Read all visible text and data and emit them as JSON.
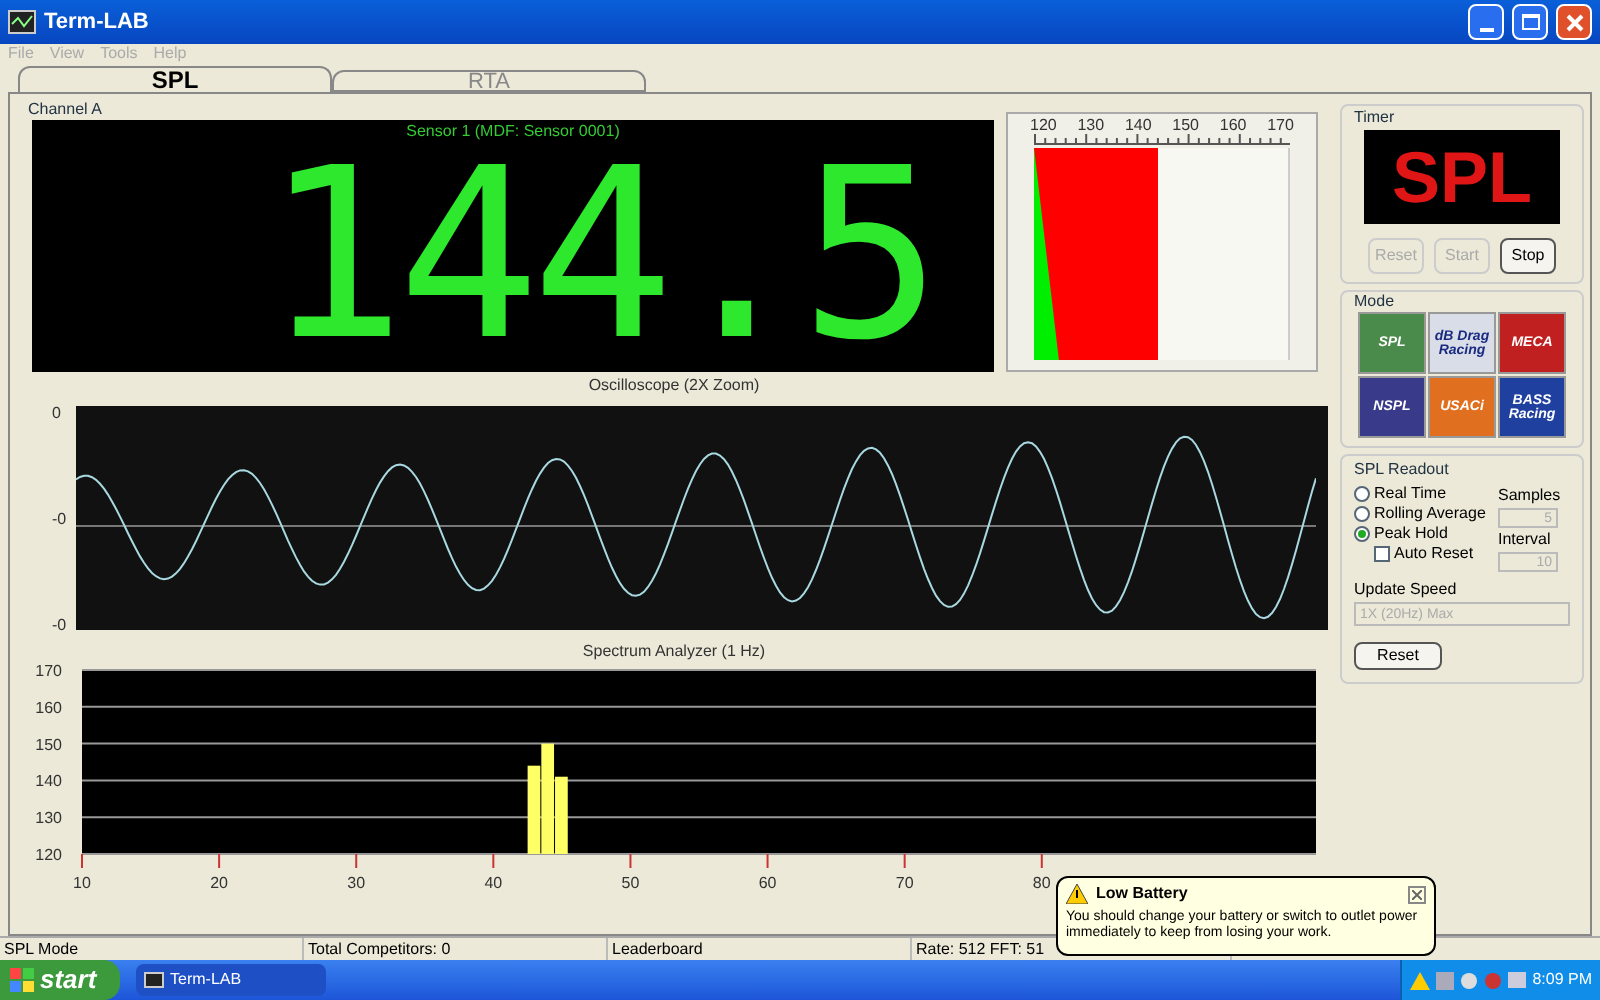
{
  "window": {
    "title": "Term-LAB"
  },
  "menu": [
    "File",
    "View",
    "Tools",
    "Help"
  ],
  "tabs": [
    {
      "label": "SPL",
      "selected": true
    },
    {
      "label": "RTA",
      "selected": false
    }
  ],
  "channel": {
    "title": "Channel A",
    "sensor": "Sensor 1 (MDF: Sensor 0001)",
    "reading": "144.5"
  },
  "meter": {
    "ticks": [
      "120",
      "130",
      "140",
      "150",
      "160",
      "170"
    ],
    "level": 0.49
  },
  "oscilloscope": {
    "title": "Oscilloscope (2X Zoom)",
    "y_labels": [
      "0",
      "-0",
      "-0"
    ]
  },
  "spectrum": {
    "title": "Spectrum Analyzer (1 Hz)",
    "chart_data": {
      "type": "bar",
      "grid": true,
      "x": [
        43,
        44,
        45
      ],
      "values": [
        144,
        150,
        141
      ],
      "xlim": [
        10,
        100
      ],
      "ylim": [
        120,
        170
      ],
      "xticks": [
        10,
        20,
        30,
        40,
        50,
        60,
        70,
        80
      ],
      "yticks": [
        120,
        130,
        140,
        150,
        160,
        170
      ]
    }
  },
  "timer": {
    "title": "Timer",
    "display": "SPL",
    "buttons": [
      {
        "label": "Reset",
        "disabled": true
      },
      {
        "label": "Start",
        "disabled": true
      },
      {
        "label": "Stop",
        "disabled": false
      }
    ]
  },
  "mode": {
    "title": "Mode",
    "logos": [
      {
        "label": "SPL",
        "color": "#4a8a4a"
      },
      {
        "label": "dB Drag Racing",
        "color": "#d8dde8"
      },
      {
        "label": "MECA",
        "color": "#c02020"
      },
      {
        "label": "NSPL",
        "color": "#3a3a8a"
      },
      {
        "label": "USACi",
        "color": "#e07020"
      },
      {
        "label": "BASS Racing",
        "color": "#2040a0"
      }
    ]
  },
  "readout": {
    "title": "SPL Readout",
    "options": [
      {
        "label": "Real Time",
        "selected": false
      },
      {
        "label": "Rolling Average",
        "selected": false
      },
      {
        "label": "Peak Hold",
        "selected": true
      }
    ],
    "auto_reset": {
      "label": "Auto Reset",
      "checked": false
    },
    "samples": {
      "label": "Samples",
      "value": "5"
    },
    "interval": {
      "label": "Interval",
      "value": "10"
    },
    "update_speed": {
      "label": "Update Speed",
      "value": "1X (20Hz) Max"
    },
    "reset": "Reset"
  },
  "status_bar": [
    "SPL Mode",
    "Total Competitors: 0",
    "Leaderboard",
    "Rate: 512 FFT: 51"
  ],
  "taskbar": {
    "start": "start",
    "task": "Term-LAB",
    "clock": "8:09 PM"
  },
  "balloon": {
    "title": "Low Battery",
    "message": "You should change your battery or switch to outlet power immediately to keep from losing your work."
  }
}
